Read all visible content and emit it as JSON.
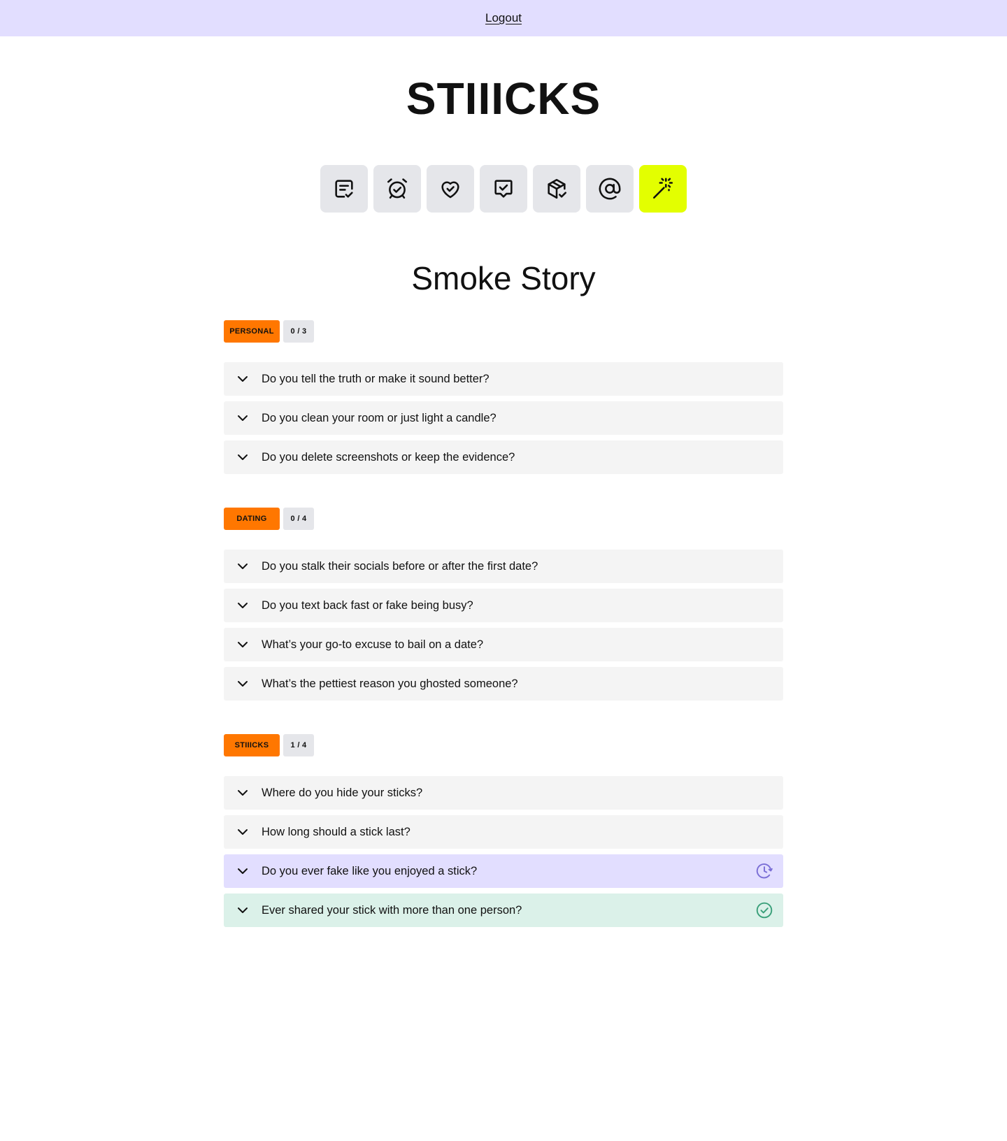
{
  "header": {
    "logout_label": "Logout"
  },
  "brand": {
    "logo_text": "STIIICKS"
  },
  "nav_icons": [
    {
      "name": "checklist-note-icon"
    },
    {
      "name": "alarm-check-icon"
    },
    {
      "name": "heart-check-icon"
    },
    {
      "name": "chat-check-icon"
    },
    {
      "name": "box-check-icon"
    },
    {
      "name": "at-sign-icon"
    },
    {
      "name": "magic-wand-icon",
      "active": true,
      "active_color": "#e3ff00"
    }
  ],
  "page": {
    "title": "Smoke Story"
  },
  "colors": {
    "topbar": "#e2deff",
    "category_tag": "#ff7700",
    "row_default": "#f4f4f4",
    "row_pending": "#e2deff",
    "row_done": "#dbf1e9",
    "pending_icon": "#7b6fd6",
    "done_icon": "#3aa07a"
  },
  "sections": [
    {
      "category": "PERSONAL",
      "progress": "0 / 3",
      "questions": [
        {
          "text": "Do you tell the truth or make it sound better?",
          "status": "none"
        },
        {
          "text": "Do you clean your room or just light a candle?",
          "status": "none"
        },
        {
          "text": "Do you delete screenshots or keep the evidence?",
          "status": "none"
        }
      ]
    },
    {
      "category": "DATING",
      "progress": "0 / 4",
      "questions": [
        {
          "text": "Do you stalk their socials before or after the first date?",
          "status": "none"
        },
        {
          "text": "Do you text back fast or fake being busy?",
          "status": "none"
        },
        {
          "text": "What’s your go-to excuse to bail on a date?",
          "status": "none"
        },
        {
          "text": "What’s the pettiest reason you ghosted someone?",
          "status": "none"
        }
      ]
    },
    {
      "category": "STIIICKS",
      "progress": "1 / 4",
      "questions": [
        {
          "text": "Where do you hide your sticks?",
          "status": "none"
        },
        {
          "text": "How long should a stick last?",
          "status": "none"
        },
        {
          "text": "Do you ever fake like you enjoyed a stick?",
          "status": "pending"
        },
        {
          "text": "Ever shared your stick with more than one person?",
          "status": "done"
        }
      ]
    }
  ]
}
